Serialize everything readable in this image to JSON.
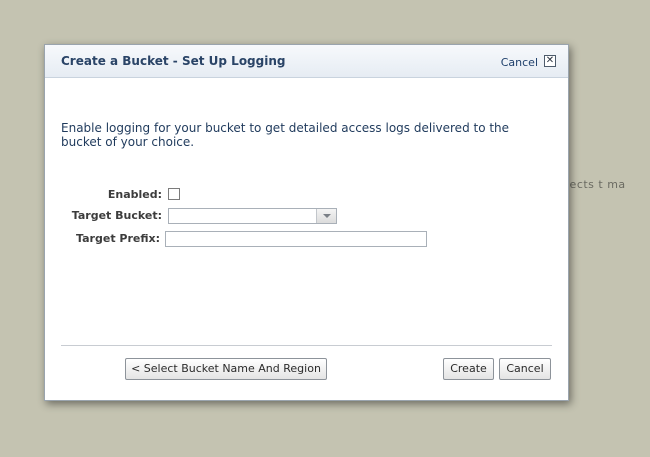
{
  "background": {
    "partial_text": "jects t ma"
  },
  "dialog": {
    "title": "Create a Bucket - Set Up Logging",
    "close_link_label": "Cancel",
    "close_x_glyph": "✕",
    "description": "Enable logging for your bucket to get detailed access logs delivered to the bucket of your choice.",
    "form": {
      "enabled_label": "Enabled:",
      "enabled_checked": false,
      "target_bucket_label": "Target Bucket:",
      "target_bucket_value": "",
      "target_prefix_label": "Target Prefix:",
      "target_prefix_value": ""
    },
    "buttons": {
      "back_label": "< Select Bucket Name And Region",
      "create_label": "Create",
      "cancel_label": "Cancel"
    }
  },
  "colors": {
    "backdrop": "#c4c3b1",
    "title_text": "#2a4467",
    "description_text": "#1f3a5c"
  },
  "icons": {
    "close": "close-icon",
    "dropdown": "chevron-down-icon"
  }
}
